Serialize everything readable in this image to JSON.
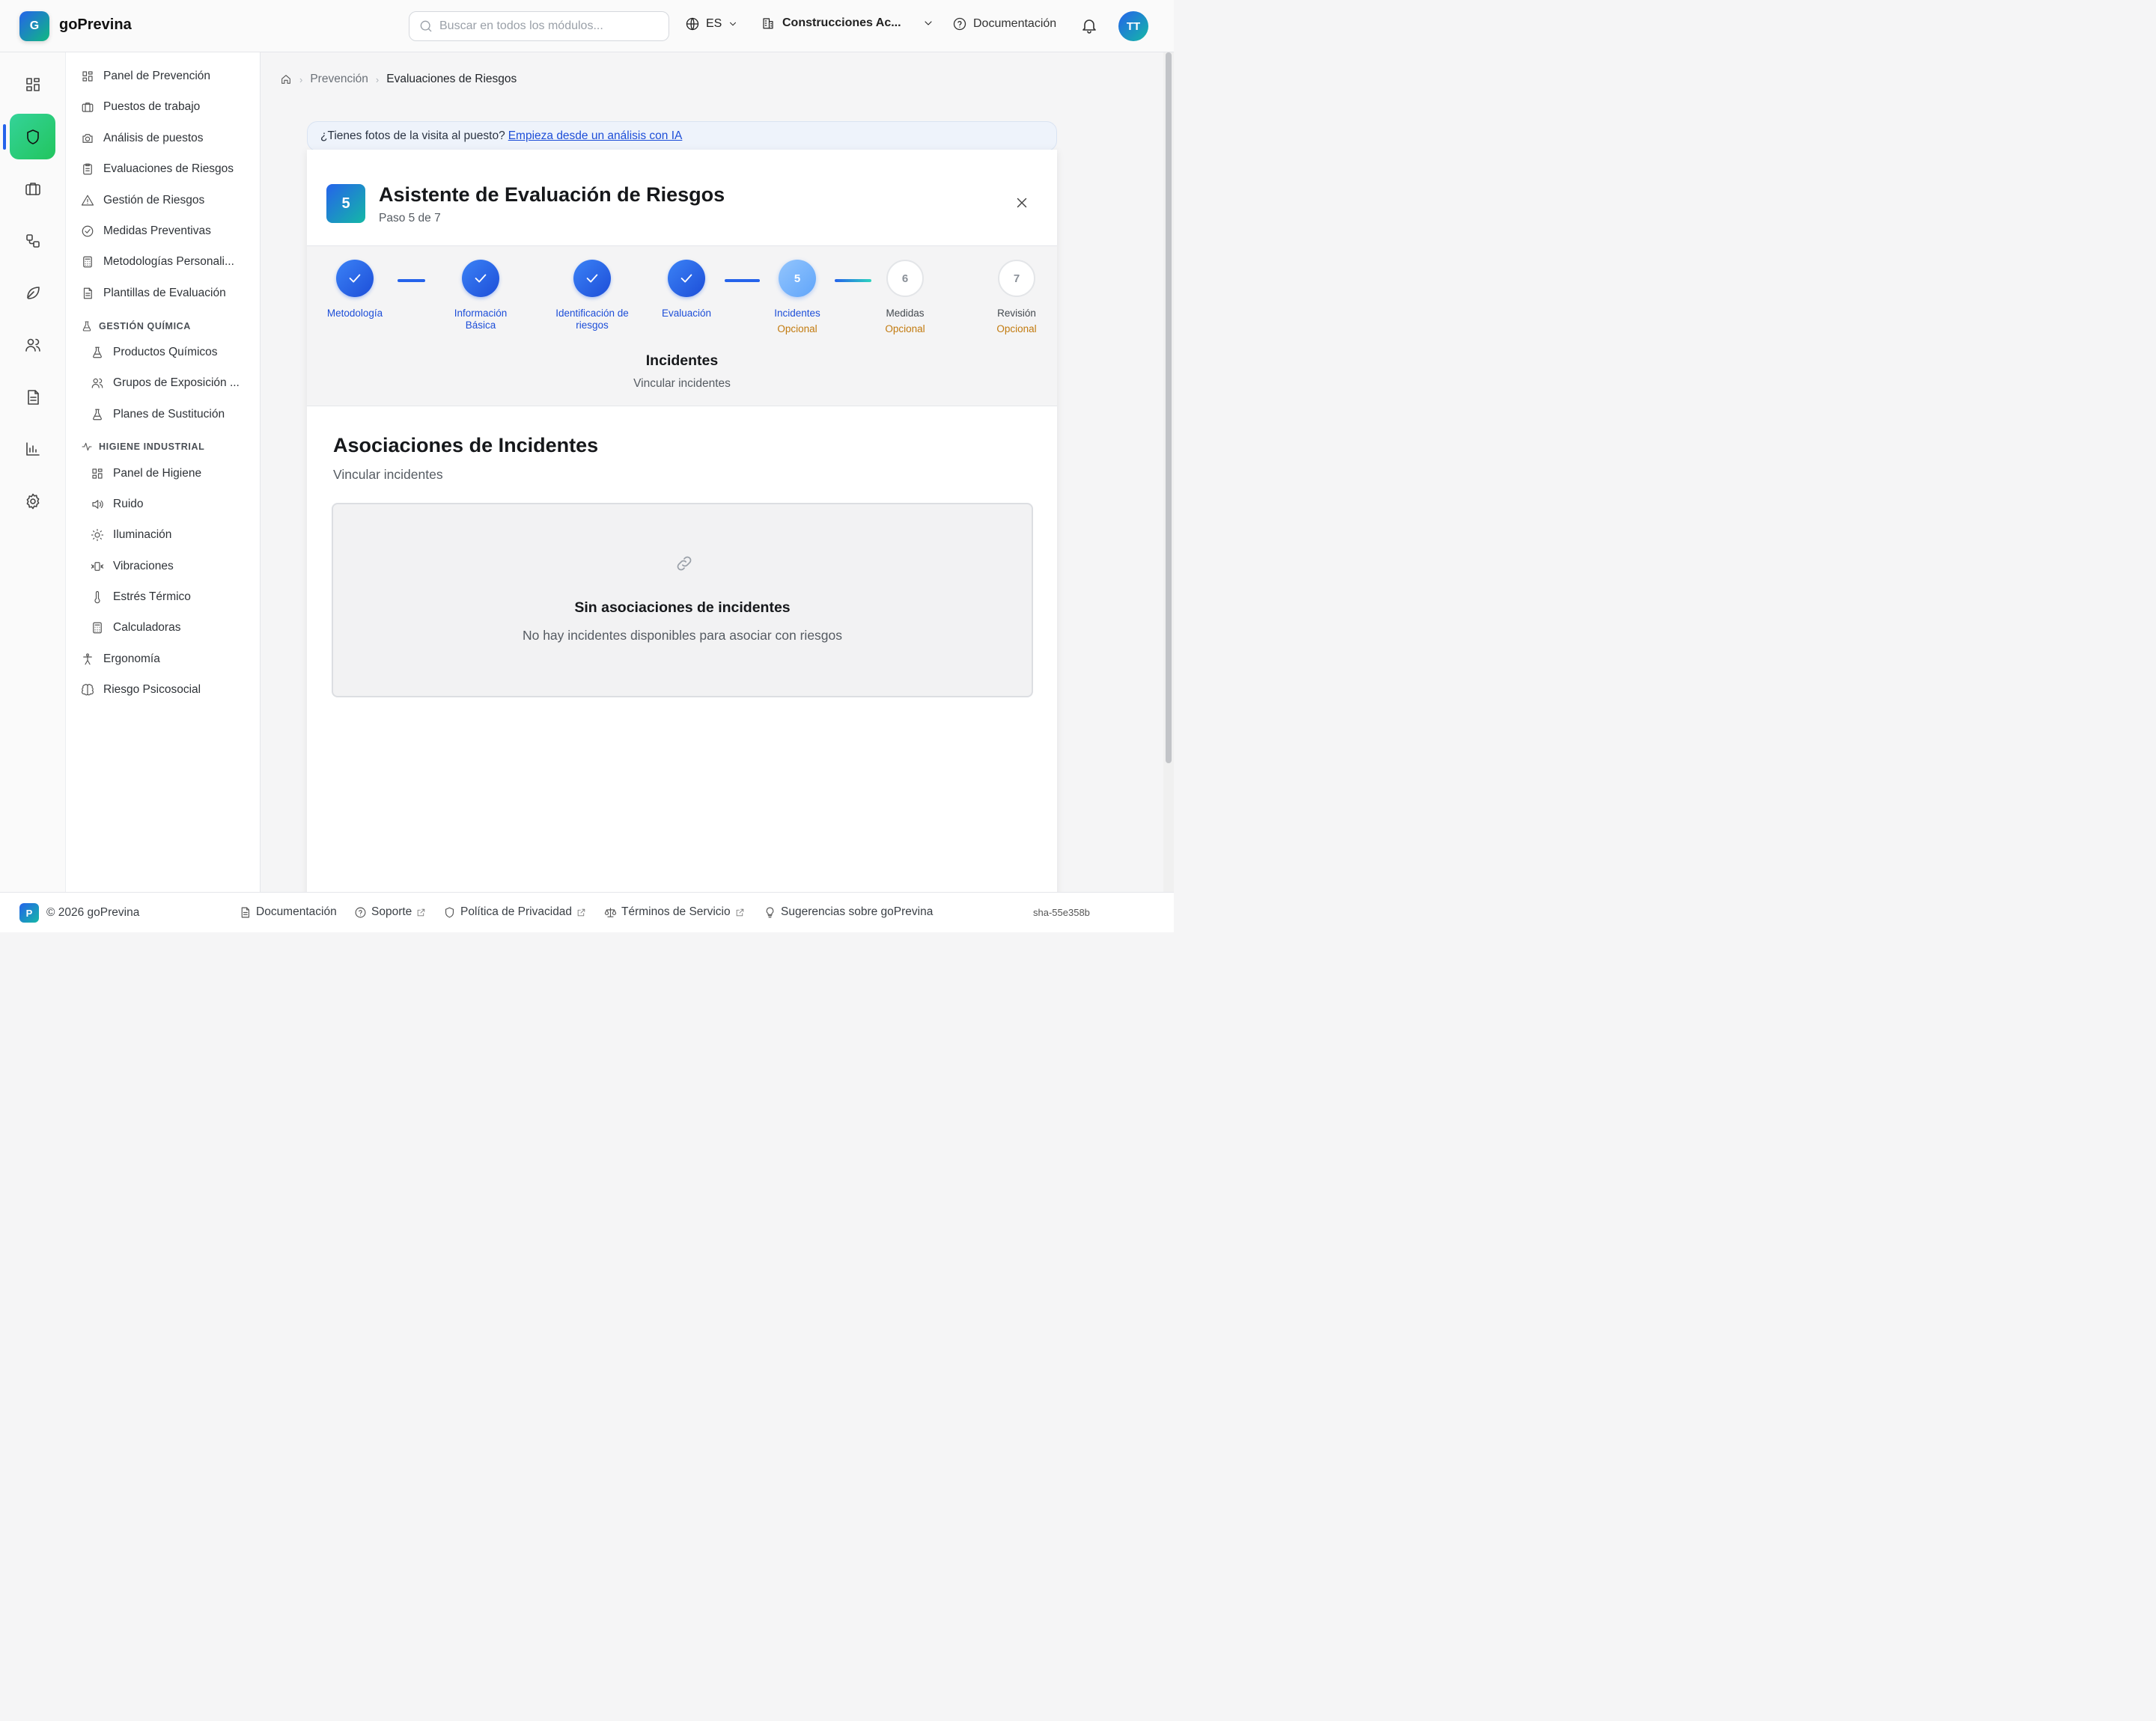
{
  "header": {
    "logo_letter": "G",
    "app_name": "goPrevina",
    "search_placeholder": "Buscar en todos los módulos...",
    "language": "ES",
    "company": "Construcciones Ac...",
    "docs_label": "Documentación",
    "avatar_initials": "TT"
  },
  "rail": {
    "icons": [
      "dashboard-icon",
      "shield-icon",
      "briefcase-icon",
      "workflow-icon",
      "leaf-icon",
      "users-icon",
      "document-icon",
      "bar-chart-icon",
      "settings-icon"
    ],
    "active": "shield-icon"
  },
  "sidebar": {
    "items": [
      {
        "label": "Panel de Prevención",
        "icon": "dashboard-icon"
      },
      {
        "label": "Puestos de trabajo",
        "icon": "briefcase-icon"
      },
      {
        "label": "Análisis de puestos",
        "icon": "camera-icon"
      },
      {
        "label": "Evaluaciones de Riesgos",
        "icon": "clipboard-icon"
      },
      {
        "label": "Gestión de Riesgos",
        "icon": "warning-icon"
      },
      {
        "label": "Medidas Preventivas",
        "icon": "check-circle-icon"
      },
      {
        "label": "Metodologías Personali...",
        "icon": "calculator-icon"
      },
      {
        "label": "Plantillas de Evaluación",
        "icon": "file-icon"
      }
    ],
    "section_chemical": "GESTIÓN QUÍMICA",
    "chemical_items": [
      {
        "label": "Productos Químicos",
        "icon": "flask-icon"
      },
      {
        "label": "Grupos de Exposición ...",
        "icon": "users-icon"
      },
      {
        "label": "Planes de Sustitución",
        "icon": "flask-icon"
      }
    ],
    "section_hygiene": "HIGIENE INDUSTRIAL",
    "hygiene_items": [
      {
        "label": "Panel de Higiene",
        "icon": "dashboard-icon"
      },
      {
        "label": "Ruido",
        "icon": "speaker-icon"
      },
      {
        "label": "Iluminación",
        "icon": "sun-icon"
      },
      {
        "label": "Vibraciones",
        "icon": "vibration-icon"
      },
      {
        "label": "Estrés Térmico",
        "icon": "thermometer-icon"
      },
      {
        "label": "Calculadoras",
        "icon": "calculator-icon"
      }
    ],
    "bottom_items": [
      {
        "label": "Ergonomía",
        "icon": "person-icon"
      },
      {
        "label": "Riesgo Psicosocial",
        "icon": "brain-icon"
      }
    ]
  },
  "breadcrumb": {
    "items": [
      "Prevención",
      "Evaluaciones de Riesgos"
    ]
  },
  "banner": {
    "text": "¿Tienes fotos de la visita al puesto?",
    "link": "Empieza desde un análisis con IA"
  },
  "wizard": {
    "badge": "5",
    "title": "Asistente de Evaluación de Riesgos",
    "subtitle": "Paso 5 de 7",
    "steps": [
      {
        "number": "1",
        "label": "Metodología",
        "status": "done",
        "optional": ""
      },
      {
        "number": "2",
        "label": "Información Básica",
        "status": "done",
        "optional": ""
      },
      {
        "number": "3",
        "label": "Identificación de riesgos",
        "status": "done",
        "optional": ""
      },
      {
        "number": "4",
        "label": "Evaluación",
        "status": "done",
        "optional": ""
      },
      {
        "number": "5",
        "label": "Incidentes",
        "status": "current",
        "optional": "Opcional"
      },
      {
        "number": "6",
        "label": "Medidas",
        "status": "todo",
        "optional": "Opcional"
      },
      {
        "number": "7",
        "label": "Revisión",
        "status": "todo",
        "optional": "Opcional"
      }
    ],
    "stage_title": "Incidentes",
    "stage_subtitle": "Vincular incidentes"
  },
  "content": {
    "title": "Asociaciones de Incidentes",
    "subtitle": "Vincular incidentes",
    "empty_title": "Sin asociaciones de incidentes",
    "empty_text": "No hay incidentes disponibles para asociar con riesgos"
  },
  "footer": {
    "logo_letter": "P",
    "copyright": "© 2026 goPrevina",
    "links": [
      {
        "label": "Documentación",
        "icon": "file-icon",
        "external": false
      },
      {
        "label": "Soporte",
        "icon": "help-icon",
        "external": true
      },
      {
        "label": "Política de Privacidad",
        "icon": "shield-icon",
        "external": true
      },
      {
        "label": "Términos de Servicio",
        "icon": "scale-icon",
        "external": true
      },
      {
        "label": "Sugerencias sobre goPrevina",
        "icon": "lightbulb-icon",
        "external": false
      }
    ],
    "build": "sha-55e358b"
  }
}
